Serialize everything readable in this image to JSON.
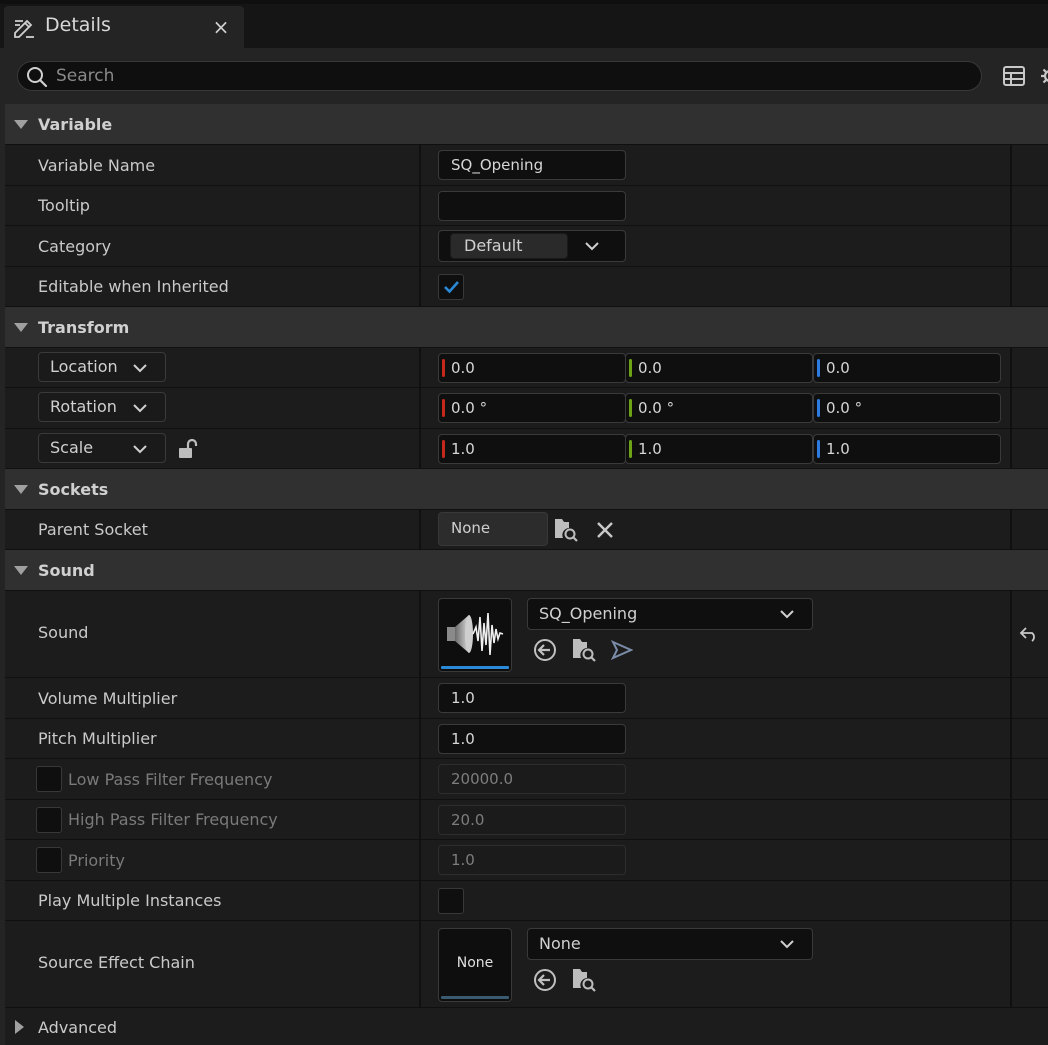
{
  "tab": {
    "title": "Details",
    "close": "×"
  },
  "search": {
    "placeholder": "Search"
  },
  "categories": {
    "variable": "Variable",
    "transform": "Transform",
    "sockets": "Sockets",
    "sound": "Sound",
    "advanced": "Advanced"
  },
  "variable": {
    "name_label": "Variable Name",
    "name_value": "SQ_Opening",
    "tooltip_label": "Tooltip",
    "tooltip_value": "",
    "category_label": "Category",
    "category_value": "Default",
    "editable_label": "Editable when Inherited",
    "editable_checked": true
  },
  "transform": {
    "location_label": "Location",
    "location": [
      "0.0",
      "0.0",
      "0.0"
    ],
    "rotation_label": "Rotation",
    "rotation": [
      "0.0 °",
      "0.0 °",
      "0.0 °"
    ],
    "scale_label": "Scale",
    "scale": [
      "1.0",
      "1.0",
      "1.0"
    ],
    "axis_colors": [
      "#c6281c",
      "#6ea318",
      "#2d7be0"
    ]
  },
  "sockets": {
    "parent_label": "Parent Socket",
    "parent_value": "None"
  },
  "sound": {
    "sound_label": "Sound",
    "sound_asset": "SQ_Opening",
    "volume_label": "Volume Multiplier",
    "volume_value": "1.0",
    "pitch_label": "Pitch Multiplier",
    "pitch_value": "1.0",
    "lowpass_label": "Low Pass Filter Frequency",
    "lowpass_value": "20000.0",
    "highpass_label": "High Pass Filter Frequency",
    "highpass_value": "20.0",
    "priority_label": "Priority",
    "priority_value": "1.0",
    "multi_label": "Play Multiple Instances",
    "multi_checked": false,
    "effect_label": "Source Effect Chain",
    "effect_thumb": "None",
    "effect_asset": "None"
  },
  "colors": {
    "accent": "#2a8ad8",
    "panel": "#242424",
    "row": "#1c1c1c",
    "category": "#303030"
  }
}
